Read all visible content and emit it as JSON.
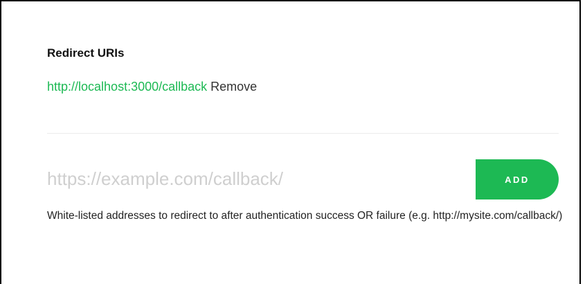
{
  "redirect_uris": {
    "title": "Redirect URIs",
    "items": [
      {
        "uri": "http://localhost:3000/callback",
        "remove_label": "Remove"
      }
    ],
    "input": {
      "value": "",
      "placeholder": "https://example.com/callback/"
    },
    "add_label": "ADD",
    "help_text": "White-listed addresses to redirect to after authentication success OR failure (e.g. http://mysite.com/callback/)"
  },
  "colors": {
    "accent": "#1db954",
    "text": "#222222",
    "placeholder": "#cfcfcf",
    "divider": "#ebebeb"
  }
}
